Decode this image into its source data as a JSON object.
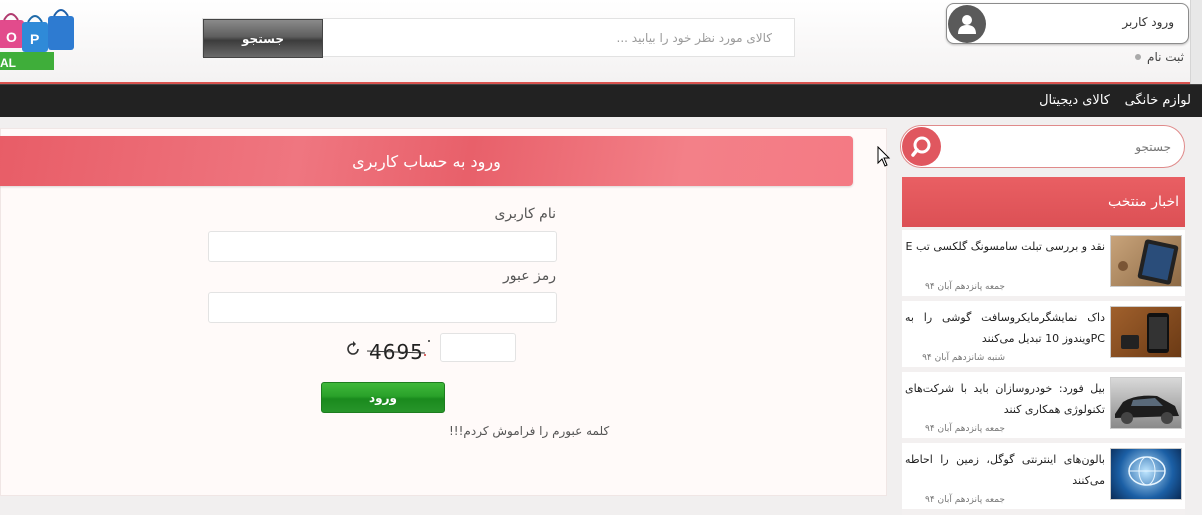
{
  "header": {
    "search_placeholder": "کالای مورد نظر خود را بیابید ...",
    "search_button": "جستجو",
    "login_label": "ورود کاربر",
    "register_label": "ثبت نام",
    "logo_letters": [
      "O",
      "P"
    ]
  },
  "navbar": {
    "items": [
      {
        "label": "لوازم خانگی"
      },
      {
        "label": "کالای دیجیتال"
      }
    ]
  },
  "sidebar": {
    "search_placeholder": "جستجو",
    "news_title": "اخبار منتخب",
    "news": [
      {
        "title": "نقد و بررسی تبلت سامسونگ گلکسی تب E",
        "date": "جمعه پانزدهم آبان ۹۴"
      },
      {
        "title": "داک نمایشگرمایکروسافت گوشی را به PCویندوز 10 تبدیل می‌کنند",
        "date": "شنبه شانزدهم آبان ۹۴"
      },
      {
        "title": "بیل فورد: خودروسازان باید با شرکت‌های تکنولوژی همکاری کنند",
        "date": "جمعه پانزدهم آبان ۹۴"
      },
      {
        "title": "بالون‌های اینترنتی گوگل، زمین را احاطه می‌کنند",
        "date": "جمعه پانزدهم آبان ۹۴"
      }
    ]
  },
  "login_form": {
    "title": "ورود به حساب کاربری",
    "username_label": "نام کاربری",
    "password_label": "رمز عبور",
    "captcha_text": "4695",
    "submit_label": "ورود",
    "forgot_label": "کلمه عبورم را فراموش کردم!!!"
  },
  "colors": {
    "accent": "#e0575f",
    "navbar": "#222222",
    "submit": "#2aa12a"
  }
}
